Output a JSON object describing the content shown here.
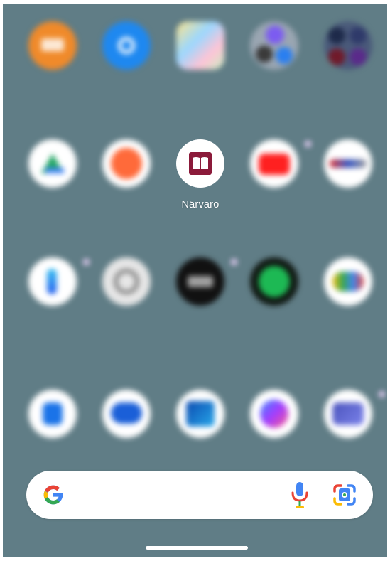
{
  "home": {
    "focused_app": {
      "label": "Närvaro",
      "icon": "open-book-icon",
      "color": "#8b1a3a"
    },
    "blurred_apps": [
      {
        "icon": "app-orange-icon",
        "color": "#f08a2a"
      },
      {
        "icon": "shazam-icon",
        "color": "#1e88f0"
      },
      {
        "icon": "google-maps-icon",
        "color": "#e8e8ef"
      },
      {
        "icon": "app-folder-icon",
        "color": "#8a9aa8"
      },
      {
        "icon": "app-folder-icon",
        "color": "#3a4a70"
      },
      {
        "icon": "google-drive-icon",
        "color": "#ffffff"
      },
      {
        "icon": "app-orange-bubble-icon",
        "color": "#ff6a3a"
      },
      {
        "icon": "youtube-icon",
        "color": "#ff2020"
      },
      {
        "icon": "app-white-icon",
        "color": "#ffffff"
      },
      {
        "icon": "bing-icon",
        "color": "#ffffff"
      },
      {
        "icon": "chatgpt-icon",
        "color": "#e6e6e6"
      },
      {
        "icon": "app-black-icon",
        "color": "#111111"
      },
      {
        "icon": "spotify-icon",
        "color": "#1db954"
      },
      {
        "icon": "google-podcasts-icon",
        "color": "#ffffff"
      },
      {
        "icon": "phone-icon",
        "color": "#ffffff"
      },
      {
        "icon": "messages-icon",
        "color": "#ffffff"
      },
      {
        "icon": "outlook-icon",
        "color": "#ffffff"
      },
      {
        "icon": "messenger-icon",
        "color": "#ffffff"
      },
      {
        "icon": "teams-icon",
        "color": "#ffffff"
      }
    ]
  },
  "search_bar": {
    "logo_icon": "google-g-icon",
    "mic_icon": "microphone-icon",
    "lens_icon": "google-lens-icon"
  }
}
